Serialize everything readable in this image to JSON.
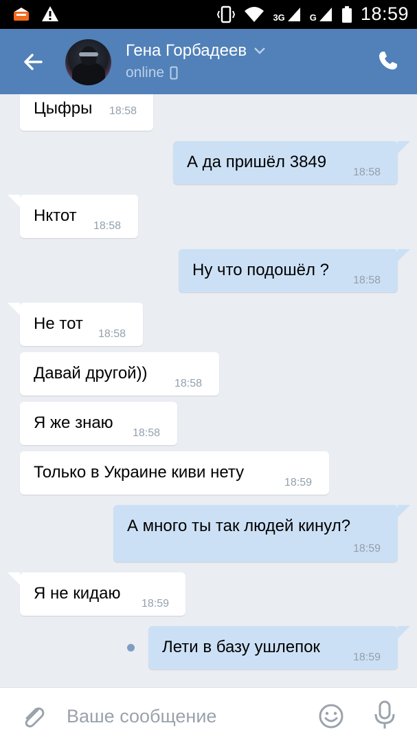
{
  "status_bar": {
    "time": "18:59",
    "net1": "3G",
    "net2": "G"
  },
  "header": {
    "name": "Гена Горбадеев",
    "status": "online"
  },
  "messages": [
    {
      "direction": "in",
      "text": "Цыфры",
      "time": "18:58"
    },
    {
      "direction": "out",
      "text": "А да пришёл 3849",
      "time": "18:58"
    },
    {
      "direction": "in",
      "text": "Нктот",
      "time": "18:58"
    },
    {
      "direction": "out",
      "text": "Ну что подошёл ?",
      "time": "18:58"
    },
    {
      "direction": "in",
      "text": "Не тот",
      "time": "18:58"
    },
    {
      "direction": "in",
      "text": "Давай другой))",
      "time": "18:58"
    },
    {
      "direction": "in",
      "text": "Я же знаю",
      "time": "18:58"
    },
    {
      "direction": "in",
      "text": "Только в Украине киви нету",
      "time": "18:59"
    },
    {
      "direction": "out",
      "text": "А много ты так людей кинул?",
      "time": "18:59"
    },
    {
      "direction": "in",
      "text": "Я не кидаю",
      "time": "18:59"
    },
    {
      "direction": "out",
      "text": "Лети в базу ушлепок",
      "time": "18:59",
      "unread": true
    }
  ],
  "composer": {
    "placeholder": "Ваше сообщение"
  },
  "colors": {
    "header_bg": "#5181b8",
    "chat_bg": "#eaedf2",
    "incoming_bubble": "#ffffff",
    "outgoing_bubble": "#cce0f5"
  },
  "icons": [
    "back-arrow-icon",
    "chevron-down-icon",
    "mobile-icon",
    "phone-icon",
    "attach-icon",
    "emoji-icon",
    "mic-icon"
  ]
}
